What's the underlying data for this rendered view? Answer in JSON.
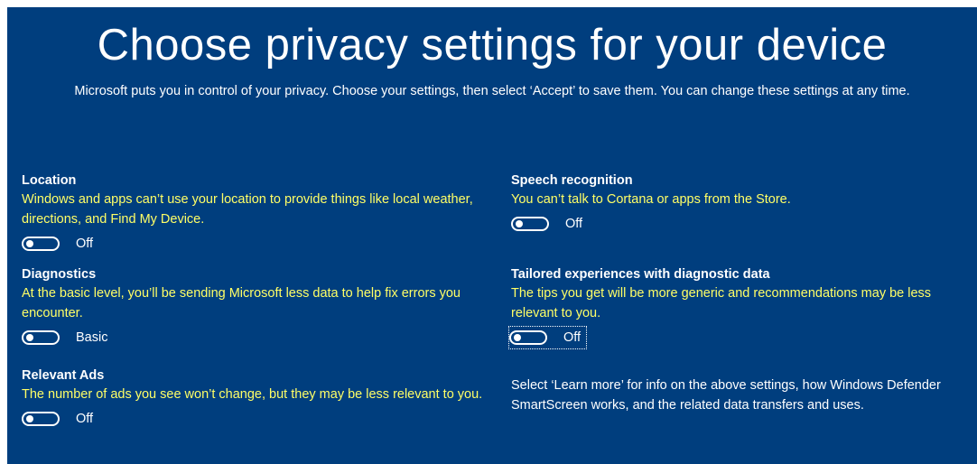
{
  "header": {
    "title": "Choose privacy settings for your device",
    "subtitle": "Microsoft puts you in control of your privacy. Choose your settings, then select ‘Accept’ to save them. You can change these settings at any time."
  },
  "settings": {
    "location": {
      "title": "Location",
      "description": "Windows and apps can’t use your location to provide things like local weather, directions, and Find My Device.",
      "state": "Off"
    },
    "diagnostics": {
      "title": "Diagnostics",
      "description": "At the basic level, you’ll be sending Microsoft less data to help fix errors you encounter.",
      "state": "Basic"
    },
    "relevant_ads": {
      "title": "Relevant Ads",
      "description": "The number of ads you see won’t change, but they may be less relevant to you.",
      "state": "Off"
    },
    "speech": {
      "title": "Speech recognition",
      "description": "You can’t talk to Cortana or apps from the Store.",
      "state": "Off"
    },
    "tailored": {
      "title": "Tailored experiences with diagnostic data",
      "description": "The tips you get will be more generic and recommendations may be less relevant to you.",
      "state": "Off"
    }
  },
  "info_text": "Select ‘Learn more’ for info on the above settings, how Windows Defender SmartScreen works, and the related data transfers and uses.",
  "colors": {
    "background": "#003e7e",
    "description": "#ffff66",
    "text": "#ffffff"
  }
}
